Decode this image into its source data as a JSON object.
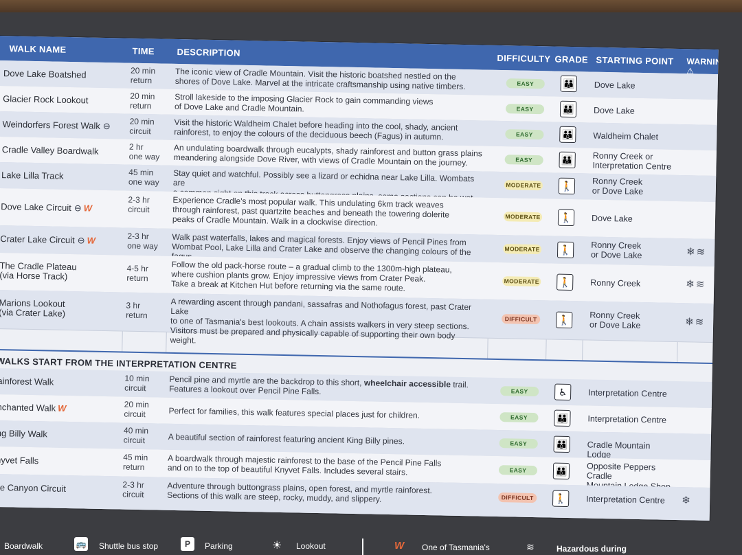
{
  "headers": {
    "walk_name": "WALK NAME",
    "time": "TIME",
    "description": "DESCRIPTION",
    "difficulty": "DIFFICULTY",
    "grade": "GRADE",
    "starting_point": "STARTING POINT",
    "warnings": "WARNINGS ⚠"
  },
  "walks": [
    {
      "name": "Dove Lake Boatshed",
      "time1": "20 min",
      "time2": "return",
      "d1": "The iconic view of Cradle Mountain. Visit the historic boatshed nestled on the",
      "d2": "shores of Dove Lake. Marvel at the intricate craftsmanship using native timbers.",
      "d3": "",
      "diff": "EASY",
      "s1": "Dove Lake",
      "s2": ""
    },
    {
      "name": "Glacier Rock Lookout",
      "time1": "20 min",
      "time2": "return",
      "d1": "Stroll lakeside to the imposing Glacier Rock to gain commanding views",
      "d2": "of Dove Lake and Cradle Mountain.",
      "d3": "",
      "diff": "EASY",
      "s1": "Dove Lake",
      "s2": ""
    },
    {
      "name": "Weindorfers Forest Walk",
      "time1": "20 min",
      "time2": "circuit",
      "d1": "Visit the historic Waldheim Chalet before heading into the cool, shady, ancient",
      "d2": "rainforest, to enjoy the colours of the deciduous beech (Fagus) in autumn.",
      "d3": "",
      "diff": "EASY",
      "s1": "Waldheim Chalet",
      "s2": ""
    },
    {
      "name": "Cradle Valley Boardwalk",
      "time1": "2 hr",
      "time2": "one way",
      "d1": "An undulating boardwalk through eucalypts, shady rainforest and button grass plains",
      "d2": "meandering alongside Dove River, with views of Cradle Mountain on the journey.",
      "d3": "",
      "diff": "EASY",
      "s1": "Ronny Creek or",
      "s2": "Interpretation Centre"
    },
    {
      "name": "Lake Lilla Track",
      "time1": "45 min",
      "time2": "one way",
      "d1": "Stay quiet and watchful. Possibly see a lizard or echidna near Lake Lilla. Wombats are",
      "d2": "a common sight on this track across buttongrass plains, some sections can be wet.",
      "d3": "",
      "diff": "MODERATE",
      "s1": "Ronny Creek",
      "s2": "or Dove Lake"
    },
    {
      "name": "Dove Lake Circuit",
      "time1": "2-3 hr",
      "time2": "circuit",
      "d1": "Experience Cradle's most popular walk. This undulating 6km track weaves",
      "d2": "through rainforest, past quartzite beaches and beneath the towering dolerite",
      "d3": "peaks of Cradle Mountain. Walk in a clockwise direction.",
      "diff": "MODERATE",
      "s1": "Dove Lake",
      "s2": ""
    },
    {
      "name": "Crater Lake Circuit",
      "time1": "2-3 hr",
      "time2": "one way",
      "d1": "Walk past waterfalls, lakes and magical forests. Enjoy views of Pencil Pines from",
      "d2": "Wombat Pool, Lake Lilla and Crater Lake and observe the changing colours of the fagus.",
      "d3": "",
      "diff": "MODERATE",
      "s1": "Ronny Creek",
      "s2": "or Dove Lake"
    },
    {
      "name": "The Cradle Plateau",
      "name2": "(via Horse Track)",
      "time1": "4-5 hr",
      "time2": "return",
      "d1": "Follow the old pack-horse route – a gradual climb to the 1300m-high plateau,",
      "d2": "where cushion plants grow. Enjoy impressive views from Crater Peak.",
      "d3": "Take a break at Kitchen Hut before returning via the same route.",
      "diff": "MODERATE",
      "s1": "Ronny Creek",
      "s2": ""
    },
    {
      "name": "Marions Lookout",
      "name2": "(via Crater Lake)",
      "time1": "3 hr",
      "time2": "return",
      "d1": "A rewarding ascent through pandani, sassafras and Nothofagus forest, past Crater Lake",
      "d2": "to one of Tasmania's best lookouts. A chain assists walkers in very steep sections.",
      "d3": "Visitors must be prepared and physically capable of supporting their own body weight.",
      "diff": "DIFFICULT",
      "s1": "Ronny Creek",
      "s2": "or Dove Lake"
    }
  ],
  "section_title": "WALKS START FROM THE INTERPRETATION CENTRE",
  "centre_walks": [
    {
      "name": "ainforest Walk",
      "time1": "10 min",
      "time2": "circuit",
      "d1": "Pencil pine and myrtle are the backdrop to this short,",
      "d1b": "wheelchair accessible",
      "d1c": "trail.",
      "d2": "Features a lookout over Pencil Pine Falls.",
      "diff": "EASY",
      "s1": "Interpretation Centre"
    },
    {
      "name": "nchanted Walk",
      "time1": "20 min",
      "time2": "circuit",
      "d1": "Perfect for families, this walk features special places just for children.",
      "d1b": "",
      "d1c": "",
      "d2": "",
      "diff": "EASY",
      "s1": "Interpretation Centre"
    },
    {
      "name": "ng Billy Walk",
      "time1": "40 min",
      "time2": "circuit",
      "d1": "A beautiful section of rainforest featuring ancient King Billy pines.",
      "d1b": "",
      "d1c": "",
      "d2": "",
      "diff": "EASY",
      "s1": "Cradle Mountain Lodge"
    },
    {
      "name": "nyvet Falls",
      "time1": "45 min",
      "time2": "return",
      "d1": "A boardwalk through majestic rainforest to the base of the Pencil Pine Falls",
      "d1b": "",
      "d1c": "",
      "d2": "and on to the top of beautiful Knyvet Falls. Includes several stairs.",
      "diff": "EASY",
      "s1": "Opposite Peppers Cradle",
      "s2": "Mountain Lodge Shop"
    },
    {
      "name": "ve Canyon Circuit",
      "time1": "2-3 hr",
      "time2": "circuit",
      "d1": "Adventure through buttongrass plains, open forest, and myrtle rainforest.",
      "d1b": "",
      "d1c": "",
      "d2": "Sections of this walk are steep, rocky, muddy, and slippery.",
      "diff": "DIFFICULT",
      "s1": "Interpretation Centre"
    }
  ],
  "legend": {
    "boardwalk": "Boardwalk",
    "shuttle": "Shuttle bus stop",
    "parking": "Parking",
    "lookout": "Lookout",
    "one_of": "One of Tasmania's",
    "hazard": "Hazardous during"
  },
  "colors": {
    "header": "#3f67ae",
    "easy": "#cfe5c5",
    "moderate": "#f4ebb5",
    "difficult": "#f3c3b0",
    "accent": "#e4683a"
  }
}
